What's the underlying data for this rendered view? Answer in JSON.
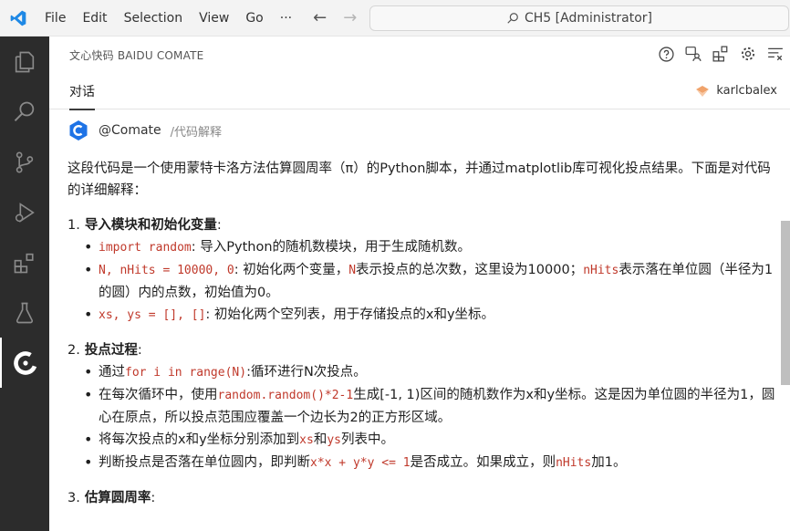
{
  "titlebar": {
    "menus": [
      "File",
      "Edit",
      "Selection",
      "View",
      "Go",
      "···"
    ],
    "search_text": "CH5 [Administrator]"
  },
  "panel": {
    "title": "文心快码 BAIDU COMATE",
    "tab": "对话",
    "user": "karlcbalex"
  },
  "agent": {
    "name": "@Comate",
    "command": "/代码解释"
  },
  "intro": "这段代码是一个使用蒙特卡洛方法估算圆周率（π）的Python脚本，并通过matplotlib库可视化投点结果。下面是对代码的详细解释：",
  "sections": {
    "s1": {
      "num": "1.",
      "title": "导入模块和初始化变量",
      "colon": ":",
      "i1_code": "import random",
      "i1_text": ": 导入Python的随机数模块，用于生成随机数。",
      "i2_code": "N, nHits = 10000, 0",
      "i2_t1": ": 初始化两个变量，",
      "i2_code2": "N",
      "i2_t2": "表示投点的总次数，这里设为10000；",
      "i2_code3": "nHits",
      "i2_t3": "表示落在单位圆（半径为1的圆）内的点数，初始值为0。",
      "i3_code": "xs, ys = [], []",
      "i3_text": ": 初始化两个空列表，用于存储投点的x和y坐标。"
    },
    "s2": {
      "num": "2.",
      "title": "投点过程",
      "colon": ":",
      "i1_t1": "通过",
      "i1_code": "for i in range(N)",
      "i1_t2": ":循环进行N次投点。",
      "i2_t1": "在每次循环中，使用",
      "i2_code": "random.random()*2-1",
      "i2_t2": "生成[-1, 1)区间的随机数作为x和y坐标。这是因为单位圆的半径为1，圆心在原点，所以投点范围应覆盖一个边长为2的正方形区域。",
      "i3_t1": "将每次投点的x和y坐标分别添加到",
      "i3_code": "xs",
      "i3_t2": "和",
      "i3_code2": "ys",
      "i3_t3": "列表中。",
      "i4_t1": "判断投点是否落在单位圆内，即判断",
      "i4_code": "x*x + y*y <= 1",
      "i4_t2": "是否成立。如果成立，则",
      "i4_code2": "nHits",
      "i4_t3": "加1。"
    },
    "s3": {
      "num": "3.",
      "title": "估算圆周率",
      "colon": ":"
    }
  },
  "colors": {
    "activitybar": "#2c2c2c",
    "code": "#c0392b",
    "accent": "#0078d4"
  }
}
